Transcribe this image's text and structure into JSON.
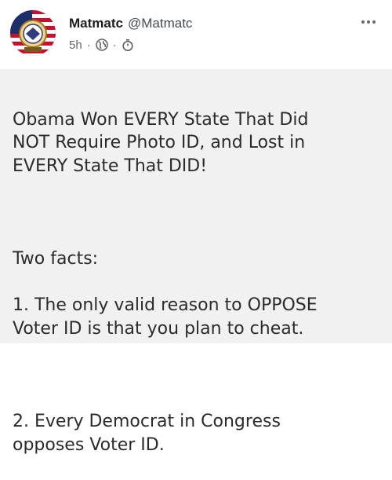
{
  "post": {
    "author_name": "Matmatc",
    "author_handle": "@Matmatc",
    "timestamp": "5h",
    "separator": "·",
    "icons": {
      "privacy": "globe-icon",
      "edit": "stopwatch-icon",
      "more": "more-icon"
    }
  },
  "image_text": {
    "headline": "Obama Won EVERY State That Did\nNOT Require Photo ID, and Lost in\nEVERY State That DID!",
    "facts_intro": "Two facts:",
    "fact_1": "1. The only valid reason to OPPOSE\nVoter ID is that you plan to cheat.",
    "fact_2": "2. Every Democrat in Congress\nopposes Voter ID."
  },
  "colors": {
    "text": "#2b2b2b",
    "image_background": "#f1f1f1",
    "meta": "#65676b"
  }
}
